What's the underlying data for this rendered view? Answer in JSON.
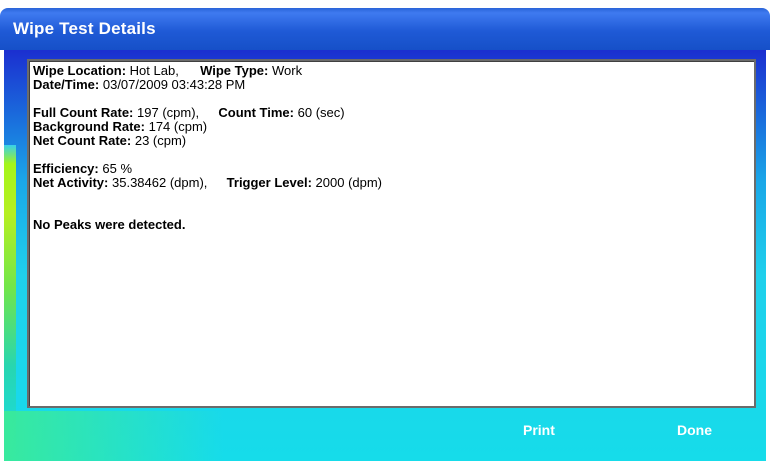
{
  "window": {
    "title": "Wipe Test Details"
  },
  "report": {
    "wipe_location_label": "Wipe Location:",
    "wipe_location_value": "Hot Lab,",
    "wipe_type_label": "Wipe Type:",
    "wipe_type_value": "Work",
    "datetime_label": "Date/Time:",
    "datetime_value": "03/07/2009 03:43:28 PM",
    "full_count_label": "Full Count Rate:",
    "full_count_value": "197 (cpm),",
    "count_time_label": "Count Time:",
    "count_time_value": "60 (sec)",
    "background_label": "Background Rate:",
    "background_value": "174 (cpm)",
    "net_count_label": "Net Count Rate:",
    "net_count_value": "23 (cpm)",
    "efficiency_label": "Efficiency:",
    "efficiency_value": "65 %",
    "net_activity_label": "Net Activity:",
    "net_activity_value": "35.38462 (dpm),",
    "trigger_label": "Trigger Level:",
    "trigger_value": "2000 (dpm)",
    "peaks_message": "No Peaks were detected."
  },
  "buttons": {
    "print": "Print",
    "done": "Done"
  },
  "colors": {
    "titlebar": "#2a64d8",
    "client_top": "#1b2fd0",
    "client_bottom": "#16dcea",
    "stripe": "#a4f51a"
  }
}
